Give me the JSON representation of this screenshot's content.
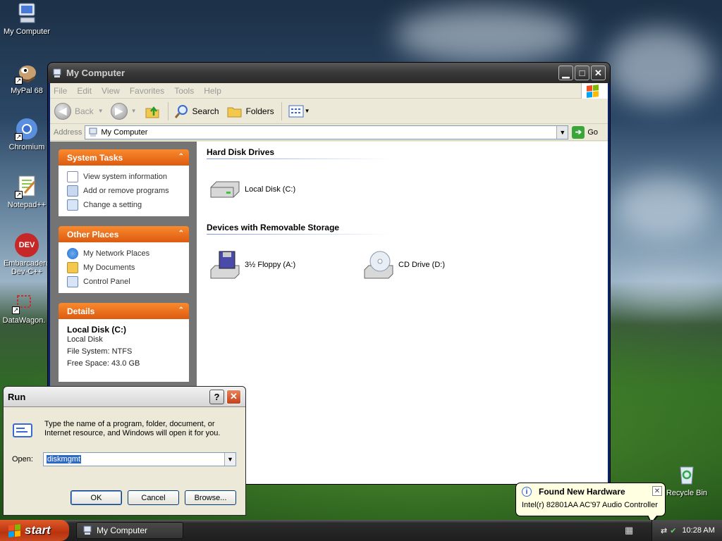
{
  "desktop": {
    "icons": [
      {
        "label": "My Computer",
        "icon": "computer-icon"
      },
      {
        "label": "MyPal 68",
        "icon": "mypal-icon"
      },
      {
        "label": "Chromium",
        "icon": "chromium-icon"
      },
      {
        "label": "Notepad++",
        "icon": "notepadpp-icon"
      },
      {
        "label": "Embarcadero Dev-C++",
        "label_line1": "Embarcadero",
        "label_line2": "Dev-C++",
        "icon_text": "DEV",
        "icon": "devcpp-icon"
      },
      {
        "label": "DataWagon.",
        "icon": "datawagon-icon"
      },
      {
        "label": "Recycle Bin",
        "icon": "recycle-bin-icon"
      }
    ]
  },
  "explorer": {
    "title": "My Computer",
    "menu": [
      "File",
      "Edit",
      "View",
      "Favorites",
      "Tools",
      "Help"
    ],
    "toolbar": {
      "back": "Back",
      "search": "Search",
      "folders": "Folders"
    },
    "address": {
      "label": "Address",
      "value": "My Computer",
      "go": "Go"
    },
    "panels": {
      "system_tasks": {
        "title": "System Tasks",
        "items": [
          "View system information",
          "Add or remove programs",
          "Change a setting"
        ]
      },
      "other_places": {
        "title": "Other Places",
        "items": [
          "My Network Places",
          "My Documents",
          "Control Panel"
        ]
      },
      "details": {
        "title": "Details",
        "name": "Local Disk (C:)",
        "type": "Local Disk",
        "filesystem": "File System: NTFS",
        "freespace": "Free Space: 43.0 GB"
      }
    },
    "groups": {
      "hard_disks": {
        "title": "Hard Disk Drives",
        "items": [
          "Local Disk (C:)"
        ]
      },
      "removable": {
        "title": "Devices with Removable Storage",
        "items": [
          "3½ Floppy (A:)",
          "CD Drive (D:)"
        ]
      }
    }
  },
  "run_dialog": {
    "title": "Run",
    "help": "?",
    "description": "Type the name of a program, folder, document, or Internet resource, and Windows will open it for you.",
    "open_label": "Open:",
    "open_value": "diskmgmt",
    "buttons": {
      "ok": "OK",
      "cancel": "Cancel",
      "browse": "Browse..."
    }
  },
  "balloon": {
    "title": "Found New Hardware",
    "message": "Intel(r) 82801AA AC'97 Audio Controller"
  },
  "taskbar": {
    "start": "start",
    "task": "My Computer",
    "clock": "10:28 AM"
  },
  "colors": {
    "panel_header": "#dd5b10",
    "titlebar": "#3a3a3a",
    "selection": "#316ac5"
  }
}
